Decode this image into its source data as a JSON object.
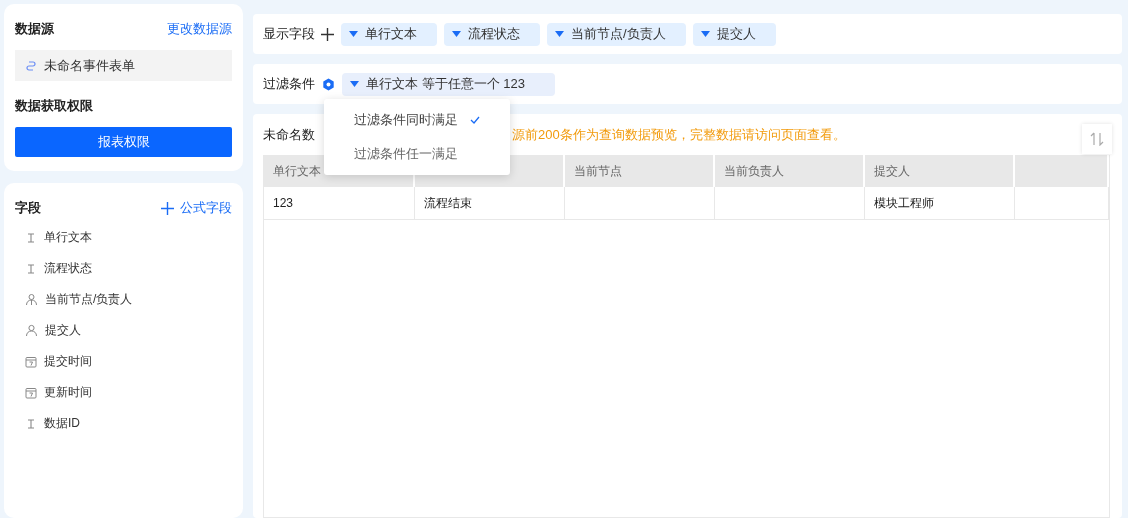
{
  "source": {
    "heading": "数据源",
    "change_link": "更改数据源",
    "form_name": "未命名事件表单"
  },
  "permission": {
    "heading": "数据获取权限",
    "button": "报表权限"
  },
  "fields": {
    "heading": "字段",
    "add_link": "公式字段",
    "items": [
      {
        "label": "单行文本",
        "kind": "text"
      },
      {
        "label": "流程状态",
        "kind": "text"
      },
      {
        "label": "当前节点/负责人",
        "kind": "people"
      },
      {
        "label": "提交人",
        "kind": "person"
      },
      {
        "label": "提交时间",
        "kind": "date"
      },
      {
        "label": "更新时间",
        "kind": "date"
      },
      {
        "label": "数据ID",
        "kind": "text"
      }
    ]
  },
  "display_fields": {
    "label": "显示字段",
    "items": [
      "单行文本",
      "流程状态",
      "当前节点/负责人",
      "提交人"
    ]
  },
  "filter": {
    "label": "过滤条件",
    "conditions": [
      "单行文本 等于任意一个 123"
    ]
  },
  "filter_menu": {
    "options": [
      {
        "label": "过滤条件同时满足",
        "selected": true
      },
      {
        "label": "过滤条件任一满足",
        "selected": false
      }
    ]
  },
  "preview": {
    "title": "未命名数",
    "notice": "源前200条作为查询数据预览，完整数据请访问页面查看。",
    "table": {
      "columns": [
        "单行文本",
        null,
        "当前节点",
        "当前负责人",
        "提交人",
        null
      ],
      "rows": [
        [
          "123",
          "流程结束",
          null,
          null,
          "模块工程师",
          null
        ]
      ]
    }
  }
}
